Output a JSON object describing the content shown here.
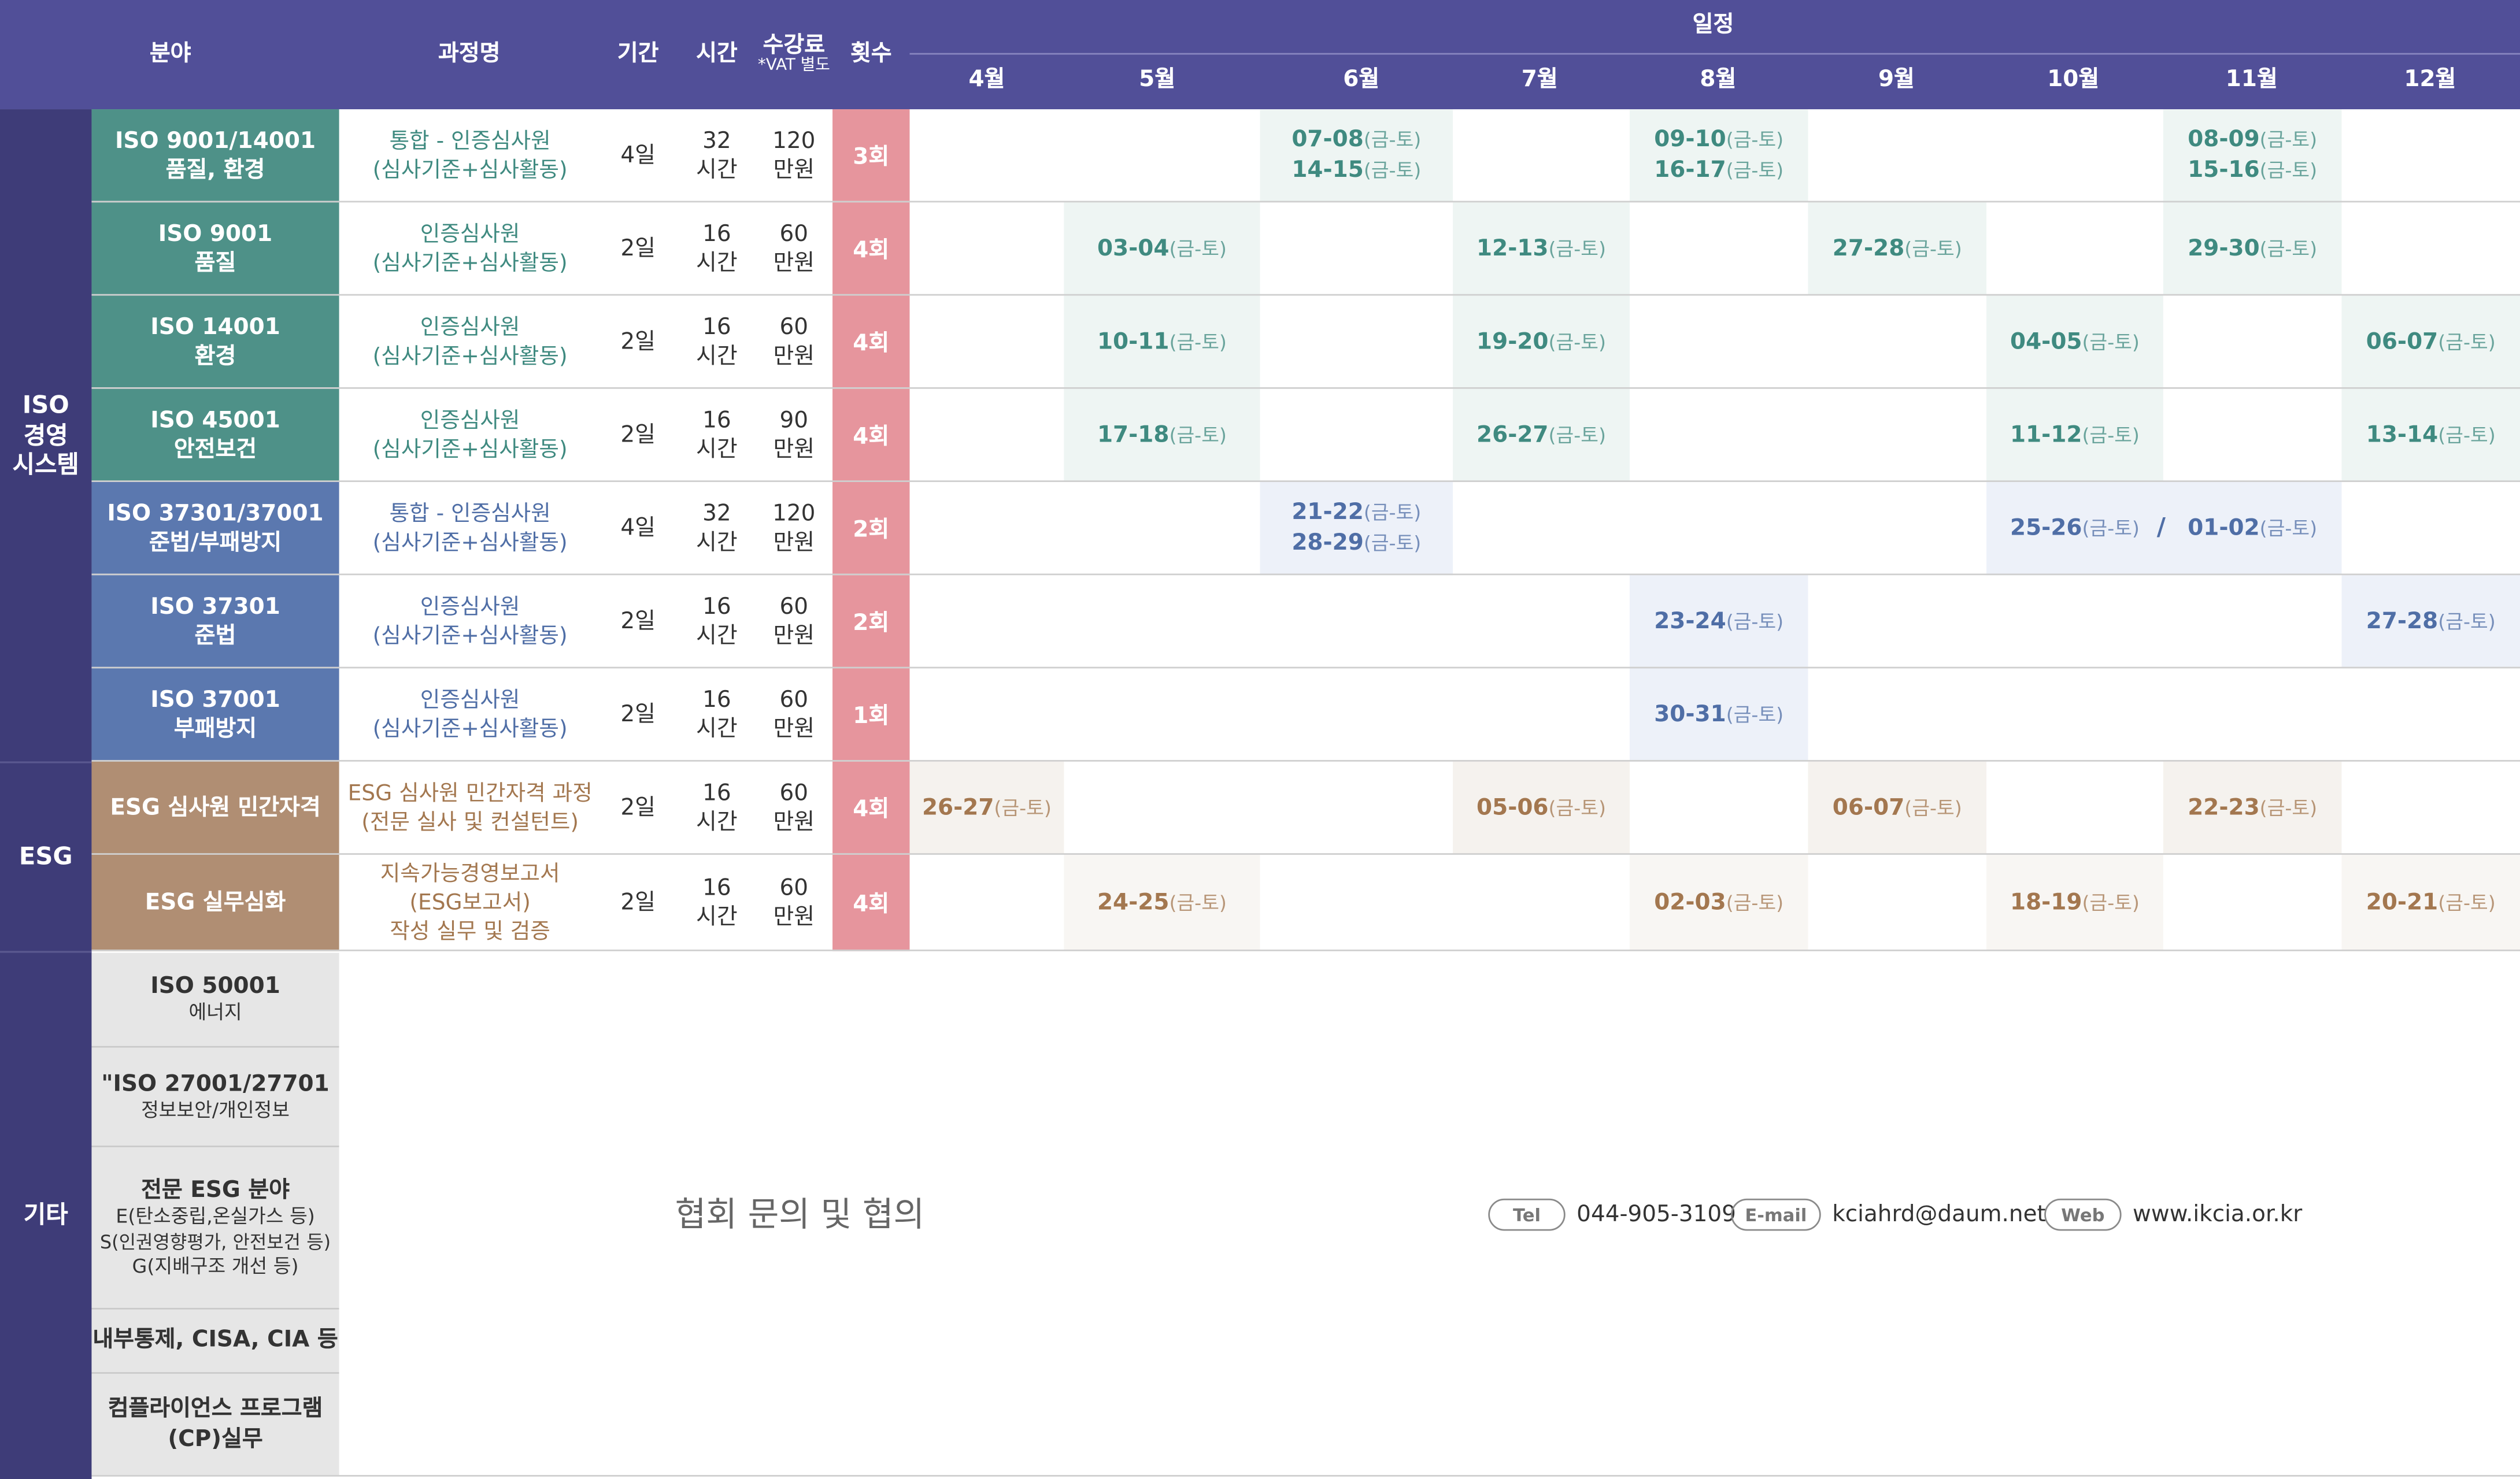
{
  "header": {
    "field": "분야",
    "course": "과정명",
    "period": "기간",
    "hours": "시간",
    "fee": "수강료",
    "fee_note": "*VAT 별도",
    "count": "횟수",
    "schedule": "일정",
    "months": [
      "4월",
      "5월",
      "6월",
      "7월",
      "8월",
      "9월",
      "10월",
      "11월",
      "12월"
    ]
  },
  "categories": {
    "iso": "ISO\n경영\n시스템",
    "esg": "ESG",
    "etc": "기타"
  },
  "rows": [
    {
      "field1": "ISO 9001/14001",
      "field2": "품질, 환경",
      "course1": "통합 - 인증심사원",
      "course2": "(심사기준+심사활동)",
      "period": "4일",
      "hours1": "32",
      "hours2": "시간",
      "fee1": "120",
      "fee2": "만원",
      "count": "3회"
    },
    {
      "field1": "ISO 9001",
      "field2": "품질",
      "course1": "인증심사원",
      "course2": "(심사기준+심사활동)",
      "period": "2일",
      "hours1": "16",
      "hours2": "시간",
      "fee1": "60",
      "fee2": "만원",
      "count": "4회"
    },
    {
      "field1": "ISO 14001",
      "field2": "환경",
      "course1": "인증심사원",
      "course2": "(심사기준+심사활동)",
      "period": "2일",
      "hours1": "16",
      "hours2": "시간",
      "fee1": "60",
      "fee2": "만원",
      "count": "4회"
    },
    {
      "field1": "ISO 45001",
      "field2": "안전보건",
      "course1": "인증심사원",
      "course2": "(심사기준+심사활동)",
      "period": "2일",
      "hours1": "16",
      "hours2": "시간",
      "fee1": "90",
      "fee2": "만원",
      "count": "4회"
    },
    {
      "field1": "ISO 37301/37001",
      "field2": "준법/부패방지",
      "course1": "통합 - 인증심사원",
      "course2": "(심사기준+심사활동)",
      "period": "4일",
      "hours1": "32",
      "hours2": "시간",
      "fee1": "120",
      "fee2": "만원",
      "count": "2회"
    },
    {
      "field1": "ISO 37301",
      "field2": "준법",
      "course1": "인증심사원",
      "course2": "(심사기준+심사활동)",
      "period": "2일",
      "hours1": "16",
      "hours2": "시간",
      "fee1": "60",
      "fee2": "만원",
      "count": "2회"
    },
    {
      "field1": "ISO 37001",
      "field2": "부패방지",
      "course1": "인증심사원",
      "course2": "(심사기준+심사활동)",
      "period": "2일",
      "hours1": "16",
      "hours2": "시간",
      "fee1": "60",
      "fee2": "만원",
      "count": "1회"
    },
    {
      "field1": "ESG 심사원 민간자격",
      "course1": "ESG 심사원 민간자격 과정",
      "course2": "(전문 실사 및 컨설턴트)",
      "period": "2일",
      "hours1": "16",
      "hours2": "시간",
      "fee1": "60",
      "fee2": "만원",
      "count": "4회"
    },
    {
      "field1": "ESG 실무심화",
      "course1": "지속가능경영보고서",
      "course2": "(ESG보고서)",
      "course3": "작성 실무 및 검증",
      "period": "2일",
      "hours1": "16",
      "hours2": "시간",
      "fee1": "60",
      "fee2": "만원",
      "count": "4회"
    }
  ],
  "day_label": "(금-토)",
  "schedule": {
    "r0_jun": [
      "07-08",
      "14-15"
    ],
    "r0_aug": [
      "09-10",
      "16-17"
    ],
    "r0_nov": [
      "08-09",
      "15-16"
    ],
    "r1_may": "03-04",
    "r1_jul": "12-13",
    "r1_sep": "27-28",
    "r1_nov": "29-30",
    "r2_may": "10-11",
    "r2_jul": "19-20",
    "r2_oct": "04-05",
    "r2_dec": "06-07",
    "r3_may": "17-18",
    "r3_jul": "26-27",
    "r3_oct": "11-12",
    "r3_dec": "13-14",
    "r4_jun": [
      "21-22",
      "28-29"
    ],
    "r4_oct": "25-26",
    "r4_slash": "/",
    "r4_nov": "01-02",
    "r5_aug": "23-24",
    "r5_dec": "27-28",
    "r6_aug": "30-31",
    "r7_apr": "26-27",
    "r7_jul": "05-06",
    "r7_sep": "06-07",
    "r7_nov": "22-23",
    "r8_may": "24-25",
    "r8_aug": "02-03",
    "r8_oct": "18-19",
    "r8_dec": "20-21"
  },
  "other_fields": [
    {
      "line1": "ISO 50001",
      "line2": "에너지"
    },
    {
      "line1": "\"ISO 27001/27701",
      "line2": "정보보안/개인정보"
    },
    {
      "line1": "전문 ESG 분야",
      "line2": "E(탄소중립,온실가스 등)",
      "line3": "S(인권영향평가, 안전보건 등)",
      "line4": "G(지배구조 개선 등)"
    },
    {
      "line1": "내부통제, CISA, CIA 등"
    },
    {
      "line1": "컴플라이언스 프로그램",
      "line2": "(CP)실무"
    }
  ],
  "inquiry": "협회 문의 및 협의",
  "contact": {
    "tel_label": "Tel",
    "tel": "044-905-3109",
    "email_label": "E-mail",
    "email": "kciahrd@daum.net",
    "web_label": "Web",
    "web": "www.ikcia.or.kr"
  }
}
